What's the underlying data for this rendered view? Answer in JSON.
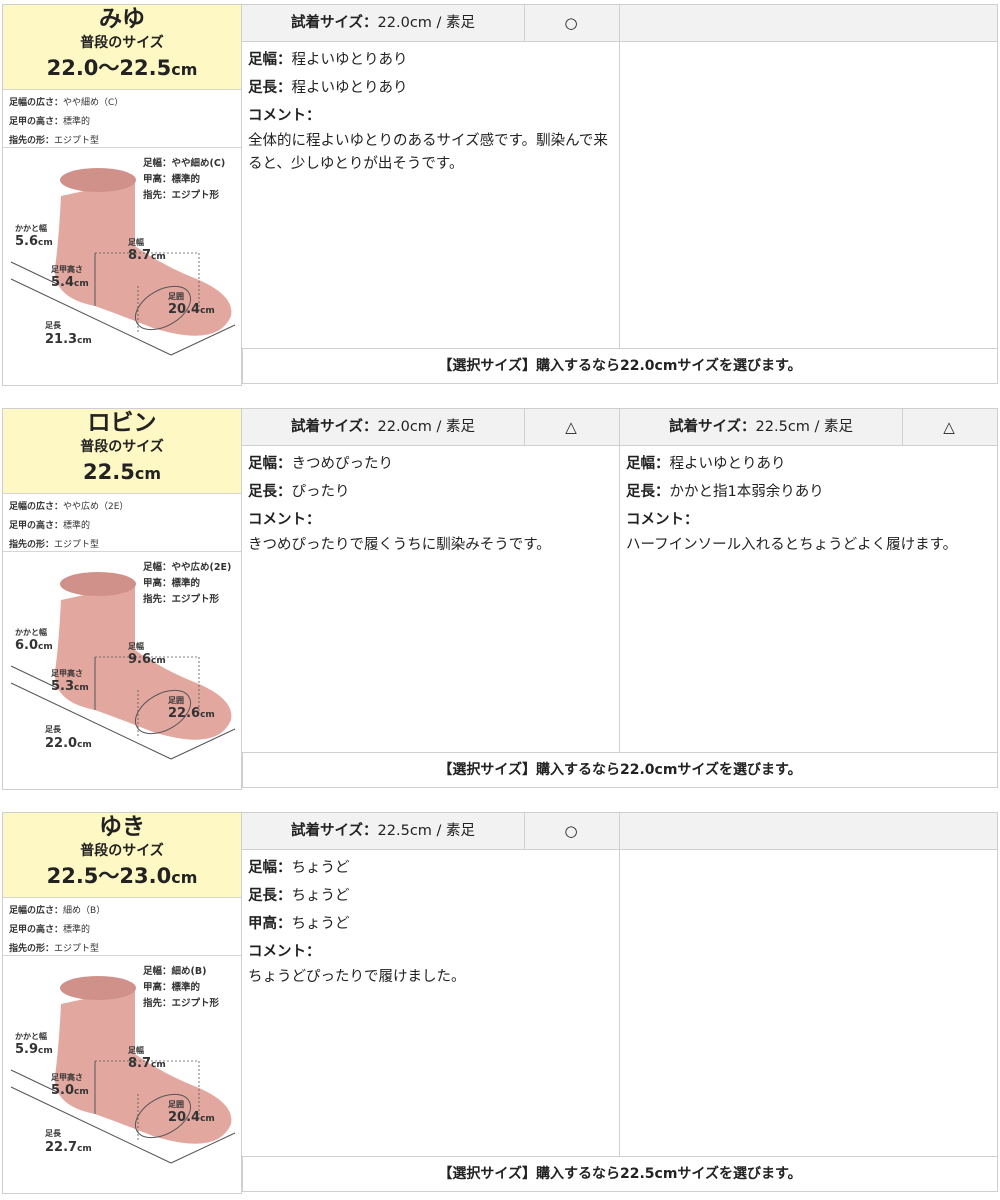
{
  "blocks": [
    {
      "name": "みゆ",
      "usual_label": "普段のサイズ",
      "usual_size": "22.0〜22.5",
      "usual_unit": "cm",
      "attrs": [
        {
          "label": "足幅の広さ：",
          "value": "やや細め（C）"
        },
        {
          "label": "足甲の高さ：",
          "value": "標準的"
        },
        {
          "label": "指先の形：",
          "value": "エジプト型"
        }
      ],
      "foot": {
        "spec_width": "足幅：やや細め(C)",
        "spec_instep": "甲高：標準的",
        "spec_toe": "指先：エジプト形",
        "heel_label": "かかと幅",
        "heel_value": "5.6",
        "heel_unit": "cm",
        "width_label": "足幅",
        "width_value": "8.7",
        "width_unit": "cm",
        "instep_label": "足甲高さ",
        "instep_value": "5.4",
        "instep_unit": "cm",
        "girth_label": "足囲",
        "girth_value": "20.4",
        "girth_unit": "cm",
        "length_label": "足長",
        "length_value": "21.3",
        "length_unit": "cm"
      },
      "trials": [
        {
          "label": "試着サイズ：",
          "value": "22.0cm / 素足",
          "mark": "○",
          "lines": [
            {
              "label": "足幅：",
              "text": "程よいゆとりあり"
            },
            {
              "label": "足長：",
              "text": "程よいゆとりあり"
            }
          ],
          "comment_label": "コメント：",
          "comment": "全体的に程よいゆとりのあるサイズ感です。馴染んで来ると、少しゆとりが出そうです。"
        },
        {
          "label": "",
          "value": "",
          "mark": "",
          "lines": [],
          "comment_label": "",
          "comment": ""
        }
      ],
      "select": "【選択サイズ】購入するなら22.0cmサイズを選びます。"
    },
    {
      "name": "ロビン",
      "usual_label": "普段のサイズ",
      "usual_size": "22.5",
      "usual_unit": "cm",
      "attrs": [
        {
          "label": "足幅の広さ：",
          "value": "やや広め（2E）"
        },
        {
          "label": "足甲の高さ：",
          "value": "標準的"
        },
        {
          "label": "指先の形：",
          "value": "エジプト型"
        }
      ],
      "foot": {
        "spec_width": "足幅：やや広め(2E)",
        "spec_instep": "甲高：標準的",
        "spec_toe": "指先：エジプト形",
        "heel_label": "かかと幅",
        "heel_value": "6.0",
        "heel_unit": "cm",
        "width_label": "足幅",
        "width_value": "9.6",
        "width_unit": "cm",
        "instep_label": "足甲高さ",
        "instep_value": "5.3",
        "instep_unit": "cm",
        "girth_label": "足囲",
        "girth_value": "22.6",
        "girth_unit": "cm",
        "length_label": "足長",
        "length_value": "22.0",
        "length_unit": "cm"
      },
      "trials": [
        {
          "label": "試着サイズ：",
          "value": "22.0cm / 素足",
          "mark": "△",
          "lines": [
            {
              "label": "足幅：",
              "text": "きつめぴったり"
            },
            {
              "label": "足長：",
              "text": "ぴったり"
            }
          ],
          "comment_label": "コメント：",
          "comment": "きつめぴったりで履くうちに馴染みそうです。"
        },
        {
          "label": "試着サイズ：",
          "value": "22.5cm / 素足",
          "mark": "△",
          "lines": [
            {
              "label": "足幅：",
              "text": "程よいゆとりあり"
            },
            {
              "label": "足長：",
              "text": "かかと指1本弱余りあり"
            }
          ],
          "comment_label": "コメント：",
          "comment": "ハーフインソール入れるとちょうどよく履けます。"
        }
      ],
      "select": "【選択サイズ】購入するなら22.0cmサイズを選びます。"
    },
    {
      "name": "ゆき",
      "usual_label": "普段のサイズ",
      "usual_size": "22.5〜23.0",
      "usual_unit": "cm",
      "attrs": [
        {
          "label": "足幅の広さ：",
          "value": "細め（B）"
        },
        {
          "label": "足甲の高さ：",
          "value": "標準的"
        },
        {
          "label": "指先の形：",
          "value": "エジプト型"
        }
      ],
      "foot": {
        "spec_width": "足幅：細め(B)",
        "spec_instep": "甲高：標準的",
        "spec_toe": "指先：エジプト形",
        "heel_label": "かかと幅",
        "heel_value": "5.9",
        "heel_unit": "cm",
        "width_label": "足幅",
        "width_value": "8.7",
        "width_unit": "cm",
        "instep_label": "足甲高さ",
        "instep_value": "5.0",
        "instep_unit": "cm",
        "girth_label": "足囲",
        "girth_value": "20.4",
        "girth_unit": "cm",
        "length_label": "足長",
        "length_value": "22.7",
        "length_unit": "cm"
      },
      "trials": [
        {
          "label": "試着サイズ：",
          "value": "22.5cm / 素足",
          "mark": "○",
          "lines": [
            {
              "label": "足幅：",
              "text": "ちょうど"
            },
            {
              "label": "足長：",
              "text": "ちょうど"
            },
            {
              "label": "甲高：",
              "text": "ちょうど"
            }
          ],
          "comment_label": "コメント：",
          "comment": "ちょうどぴったりで履けました。"
        },
        {
          "label": "",
          "value": "",
          "mark": "",
          "lines": [],
          "comment_label": "",
          "comment": ""
        }
      ],
      "select": "【選択サイズ】購入するなら22.5cmサイズを選びます。"
    }
  ],
  "colors": {
    "name_bg": "#fdf8c4",
    "foot_fill": "#e2a79f",
    "foot_top": "#cf9189",
    "border": "#cfcfcf",
    "header_bg": "#f2f2f2"
  }
}
